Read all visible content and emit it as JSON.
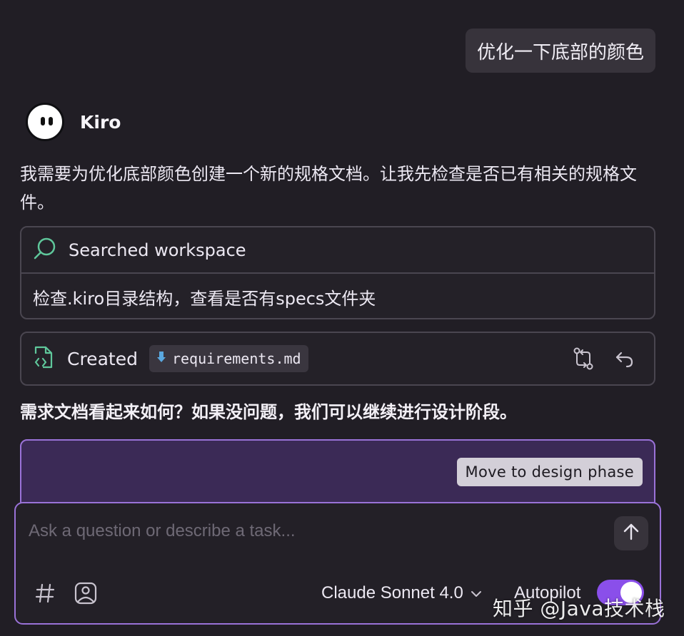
{
  "user_message": "优化一下底部的颜色",
  "agent": {
    "name": "Kiro",
    "message": "我需要为优化底部颜色创建一个新的规格文档。让我先检查是否已有相关的规格文件。"
  },
  "search_card": {
    "title": "Searched workspace",
    "detail": "检查.kiro目录结构，查看是否有specs文件夹",
    "icon": "search-icon"
  },
  "created_card": {
    "label": "Created",
    "file_name": "requirements.md",
    "icons": [
      "file-code-icon",
      "file-download-icon",
      "compare-icon",
      "undo-icon"
    ]
  },
  "question": "需求文档看起来如何？如果没问题，我们可以继续进行设计阶段。",
  "phase_button": "Move to design phase",
  "composer": {
    "placeholder": "Ask a question or describe a task...",
    "model": "Claude Sonnet 4.0",
    "autopilot_label": "Autopilot",
    "autopilot_on": true,
    "tool_icons": [
      "hash-icon",
      "image-icon"
    ],
    "send_icon": "arrow-up-icon"
  },
  "watermark": "知乎 @Java技术栈",
  "colors": {
    "background": "#211e25",
    "accent": "#9a72d8",
    "toggle": "#8a4fea",
    "panel": "#3b2a56"
  }
}
